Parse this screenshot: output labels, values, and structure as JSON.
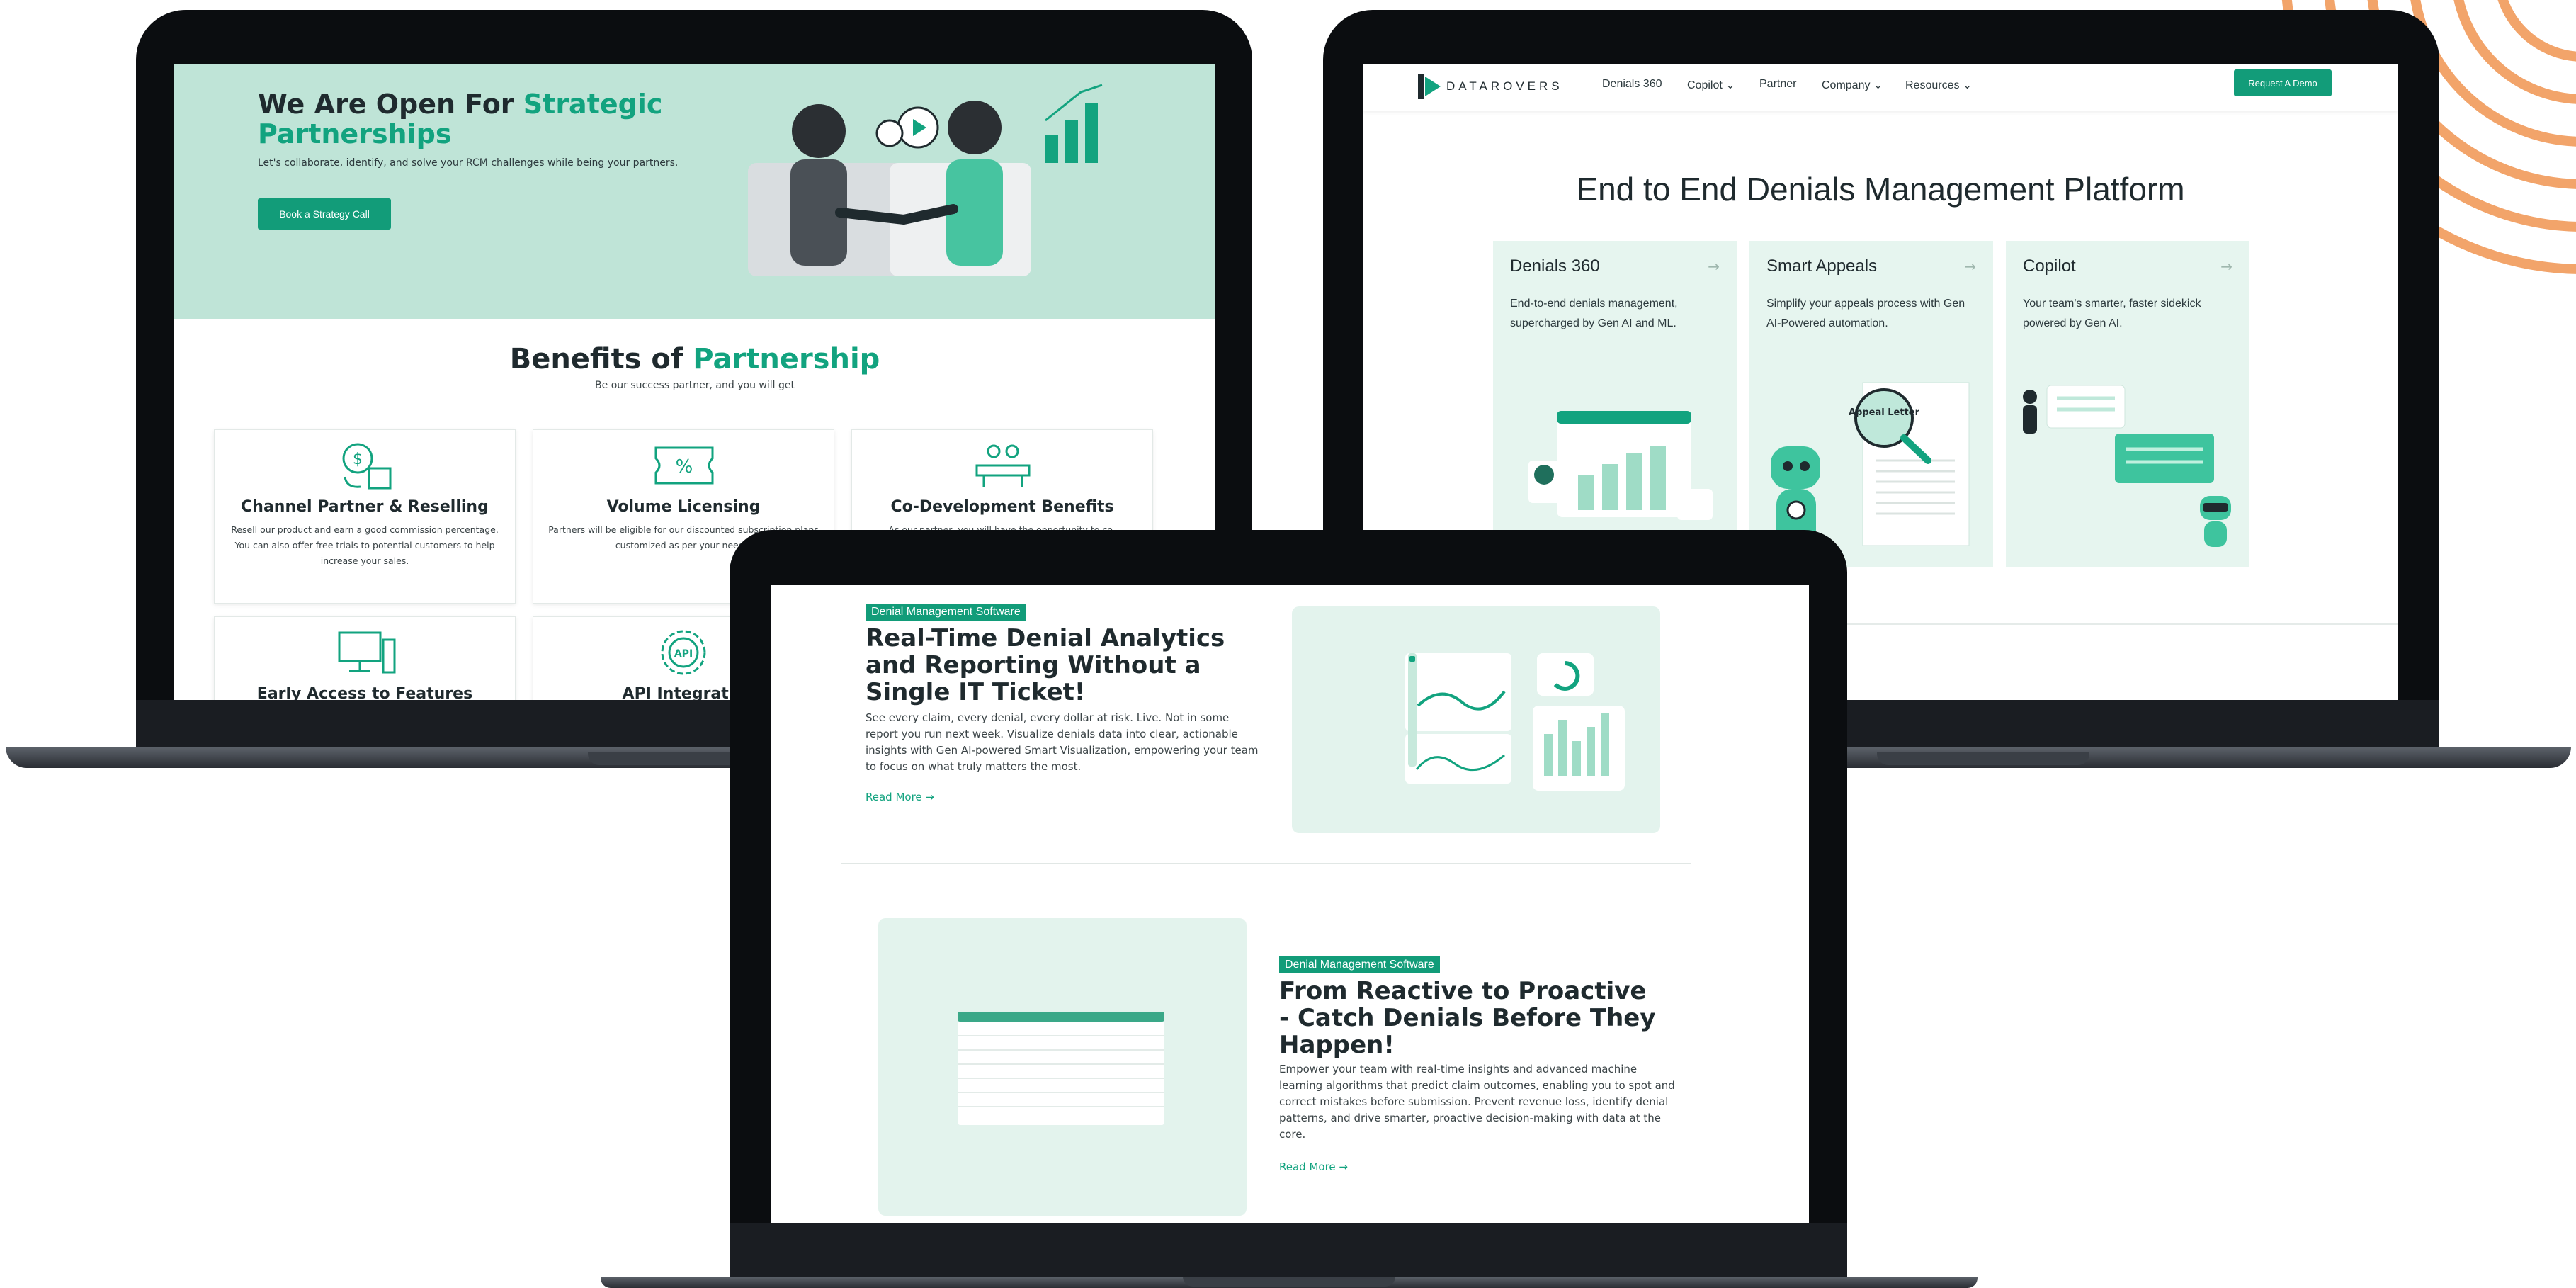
{
  "colors": {
    "accent": "#12a37f",
    "mint_bg": "#bfe4d7",
    "card_bg": "#e6f5ef",
    "arc": "#f2a46a"
  },
  "laptop_partnership": {
    "hero": {
      "title_prefix": "We Are Open For ",
      "title_highlight": "Strategic Partnerships",
      "subtitle": "Let's collaborate, identify, and solve your RCM challenges while being your partners.",
      "cta": "Book a Strategy Call"
    },
    "benefits": {
      "title_prefix": "Benefits of ",
      "title_highlight": "Partnership",
      "tagline": "Be our success partner, and you will get",
      "cards": [
        {
          "icon": "dollar-box-icon",
          "title": "Channel Partner & Reselling",
          "desc": "Resell our product and earn a good commission percentage. You can also offer free trials to potential customers to help increase your sales."
        },
        {
          "icon": "percent-ticket-icon",
          "title": "Volume Licensing",
          "desc": "Partners will be eligible for our discounted subscription plans customized as per your needs."
        },
        {
          "icon": "team-table-icon",
          "title": "Co-Development Benefits",
          "desc": "As our partner, you will have the opportunity to co-"
        },
        {
          "icon": "computer-icon",
          "title": "Early Access to Features",
          "desc": ""
        },
        {
          "icon": "api-gear-icon",
          "title": "API Integratio",
          "desc": ""
        }
      ]
    }
  },
  "laptop_platform": {
    "nav": {
      "logo": "DATAROVERS",
      "items": [
        "Denials 360",
        "Copilot",
        "Partner",
        "Company",
        "Resources"
      ],
      "cta": "Request A Demo"
    },
    "title": "End to End Denials Management Platform",
    "products": [
      {
        "title": "Denials 360",
        "desc": "End-to-end denials management, supercharged by Gen AI and ML."
      },
      {
        "title": "Smart Appeals",
        "desc": "Simplify your appeals process with Gen AI-Powered automation."
      },
      {
        "title": "Copilot",
        "desc": "Your team's smarter, faster sidekick powered by Gen AI."
      }
    ],
    "appeal_label": "Appeal Letter"
  },
  "laptop_features": {
    "section1": {
      "tag": "Denial Management Software",
      "title": "Real-Time Denial Analytics and Reporting Without a Single IT Ticket!",
      "desc": "See every claim, every denial, every dollar at risk. Live. Not in some report you run next week. Visualize denials data into clear, actionable insights with Gen AI-powered Smart Visualization, empowering your team to focus on what truly matters the most.",
      "link": "Read More"
    },
    "section2": {
      "tag": "Denial Management Software",
      "title": "From Reactive to Proactive - Catch Denials Before They Happen!",
      "desc": "Empower your team with real-time insights and advanced machine learning algorithms that predict claim outcomes, enabling you to spot and correct mistakes before submission. Prevent revenue loss, identify denial patterns, and drive smarter, proactive decision-making with data at the core.",
      "link": "Read More"
    }
  }
}
